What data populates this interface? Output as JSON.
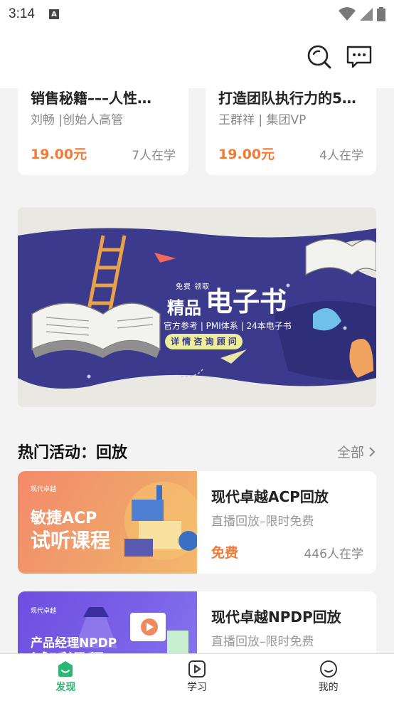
{
  "status_bar": {
    "time": "3:14"
  },
  "top_courses": [
    {
      "title": "销售秘籍–––人性…",
      "author": "刘畅 |创始人高管",
      "price": "19.00元",
      "learners": "7人在学"
    },
    {
      "title": "打造团队执行力的5…",
      "author": "王群祥 | 集团VP",
      "price": "19.00元",
      "learners": "4人在学"
    }
  ],
  "banner": {
    "tag": "免费 领取",
    "title_small": "精品",
    "title_big": "电子书",
    "subtitle": "官方参考 | PMI体系 | 24本电子书",
    "cta": "详 情 咨 询 顾 问"
  },
  "section": {
    "title": "热门活动：回放",
    "all_label": "全部"
  },
  "activities": [
    {
      "title": "现代卓越ACP回放",
      "subtitle": "直播回放–限时免费",
      "price": "免费",
      "learners": "446人在学",
      "thumb_line1": "敏捷ACP",
      "thumb_line2": "试听课程",
      "thumb_brand": "现代卓越"
    },
    {
      "title": "现代卓越NPDP回放",
      "subtitle": "直播回放–限时免费",
      "price": "",
      "learners": "",
      "thumb_line1": "产品经理NPDP",
      "thumb_line2": "试听课程",
      "thumb_brand": "现代卓越"
    }
  ],
  "bottom_nav": [
    {
      "label": "发现",
      "icon": "discover-icon",
      "active": true
    },
    {
      "label": "学习",
      "icon": "play-icon",
      "active": false
    },
    {
      "label": "我的",
      "icon": "smile-icon",
      "active": false
    }
  ],
  "colors": {
    "accent": "#2bb673",
    "price": "#f27a34",
    "banner_bg": "#3b3a8c"
  }
}
